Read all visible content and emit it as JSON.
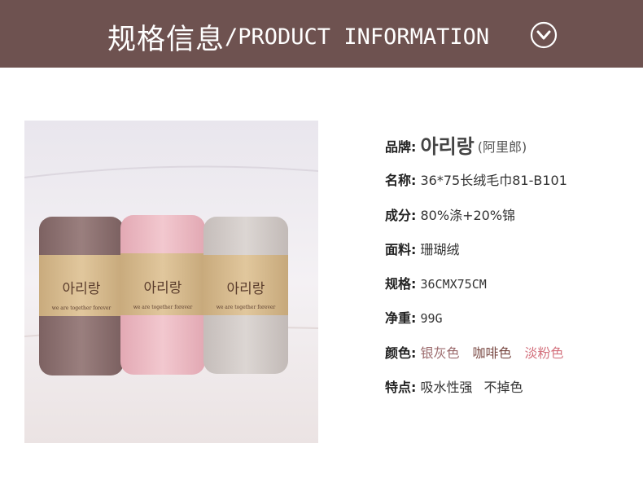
{
  "header": {
    "title_cn": "规格信息",
    "title_en": "/PRODUCT INFORMATION",
    "icon": "chevron-down-circle-icon"
  },
  "photo": {
    "towel_brand": "아리랑",
    "towel_tagline": "we are together forever",
    "colors": [
      "#8f7372",
      "#eab7c0",
      "#d3cbc8"
    ]
  },
  "specs": {
    "brand": {
      "label": "品牌:",
      "value": "아리랑",
      "sub": "(阿里郎)"
    },
    "name": {
      "label": "名称:",
      "value": "36*75长绒毛巾81-B101"
    },
    "composition": {
      "label": "成分:",
      "value": "80%涤+20%锦"
    },
    "fabric": {
      "label": "面料:",
      "value": "珊瑚绒"
    },
    "size": {
      "label": "规格:",
      "value": "36CMX75CM"
    },
    "weight": {
      "label": "净重:",
      "value": "99G"
    },
    "color": {
      "label": "颜色:",
      "values": [
        "银灰色",
        "咖啡色",
        "淡粉色"
      ]
    },
    "feature": {
      "label": "特点:",
      "values": [
        "吸水性强",
        "不掉色"
      ]
    }
  }
}
